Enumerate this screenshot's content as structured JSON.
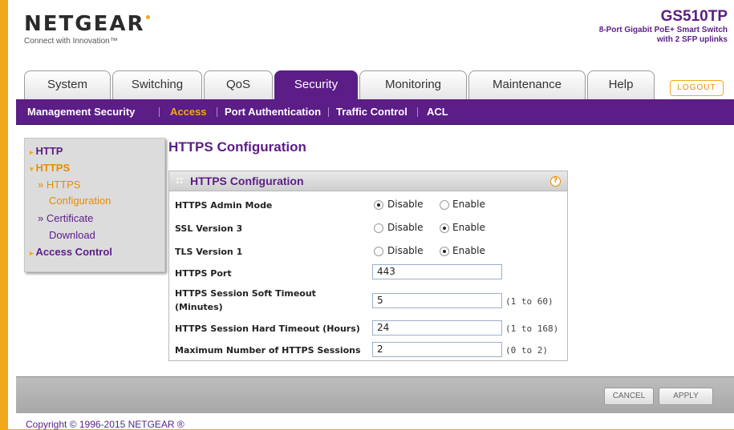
{
  "header": {
    "logo": "NETGEAR",
    "tagline": "Connect with Innovation™",
    "model": "GS510TP",
    "model_desc_1": "8-Port Gigabit PoE+ Smart Switch",
    "model_desc_2": "with 2 SFP uplinks"
  },
  "tabs": [
    "System",
    "Switching",
    "QoS",
    "Security",
    "Monitoring",
    "Maintenance",
    "Help"
  ],
  "active_tab": "Security",
  "logout": "LOGOUT",
  "subnav": [
    "Management Security",
    "Access",
    "Port Authentication",
    "Traffic Control",
    "ACL"
  ],
  "active_subnav": "Access",
  "sidebar": {
    "items": [
      {
        "label": "HTTP"
      },
      {
        "label": "HTTPS"
      },
      {
        "label": "HTTPS"
      },
      {
        "label": "Configuration"
      },
      {
        "label": "Certificate"
      },
      {
        "label": "Download"
      },
      {
        "label": "Access Control"
      }
    ]
  },
  "page_title": "HTTPS Configuration",
  "panel": {
    "title": "HTTPS Configuration",
    "help_icon": "?",
    "disable_label": "Disable",
    "enable_label": "Enable",
    "rows": [
      {
        "label": "HTTPS Admin Mode",
        "value": "Disable"
      },
      {
        "label": "SSL Version 3",
        "value": "Enable"
      },
      {
        "label": "TLS Version 1",
        "value": "Enable"
      }
    ],
    "fields": [
      {
        "label": "HTTPS Port",
        "value": "443",
        "range": ""
      },
      {
        "label": "HTTPS Session Soft Timeout",
        "label2": "(Minutes)",
        "value": "5",
        "range": "(1 to 60)"
      },
      {
        "label": "HTTPS Session Hard Timeout (Hours)",
        "value": "24",
        "range": "(1 to 168)"
      },
      {
        "label": "Maximum Number of HTTPS Sessions",
        "value": "2",
        "range": "(0 to 2)"
      }
    ]
  },
  "buttons": {
    "cancel": "CANCEL",
    "apply": "APPLY"
  },
  "copyright": "Copyright © 1996-2015 NETGEAR ®",
  "colors": {
    "brand_purple": "#5b1d86",
    "brand_orange": "#f2a81d"
  }
}
